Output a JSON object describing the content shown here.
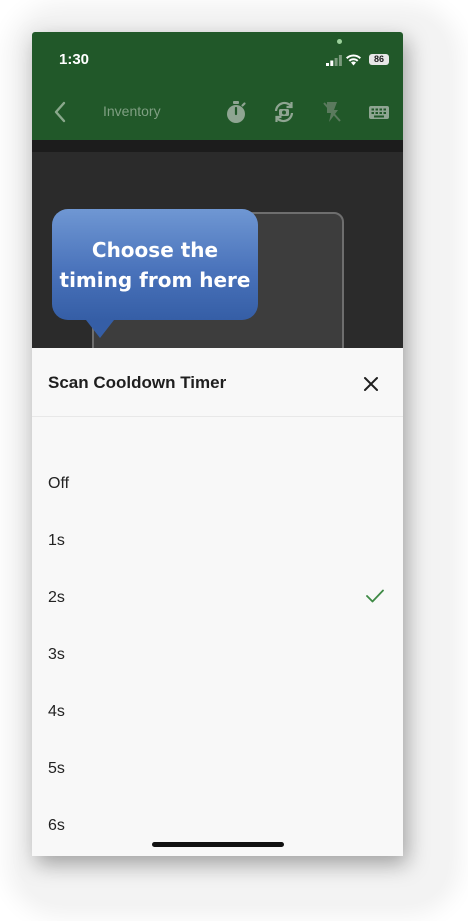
{
  "status_bar": {
    "time": "1:30",
    "battery": "86"
  },
  "nav": {
    "title": "Inventory",
    "icons": [
      "back-icon",
      "stopwatch-icon",
      "camera-rotate-icon",
      "flash-icon",
      "keyboard-icon"
    ]
  },
  "tooltip": {
    "line1": "Choose the",
    "line2": "timing from here"
  },
  "sheet": {
    "title": "Scan Cooldown Timer",
    "options": [
      {
        "label": "Off"
      },
      {
        "label": "1s"
      },
      {
        "label": "2s"
      },
      {
        "label": "3s"
      },
      {
        "label": "4s"
      },
      {
        "label": "5s"
      },
      {
        "label": "6s"
      }
    ],
    "selected": "2s"
  },
  "colors": {
    "header_green": "#215829",
    "tooltip_blue": "#4a73bb",
    "check_green": "#3e8a45"
  }
}
